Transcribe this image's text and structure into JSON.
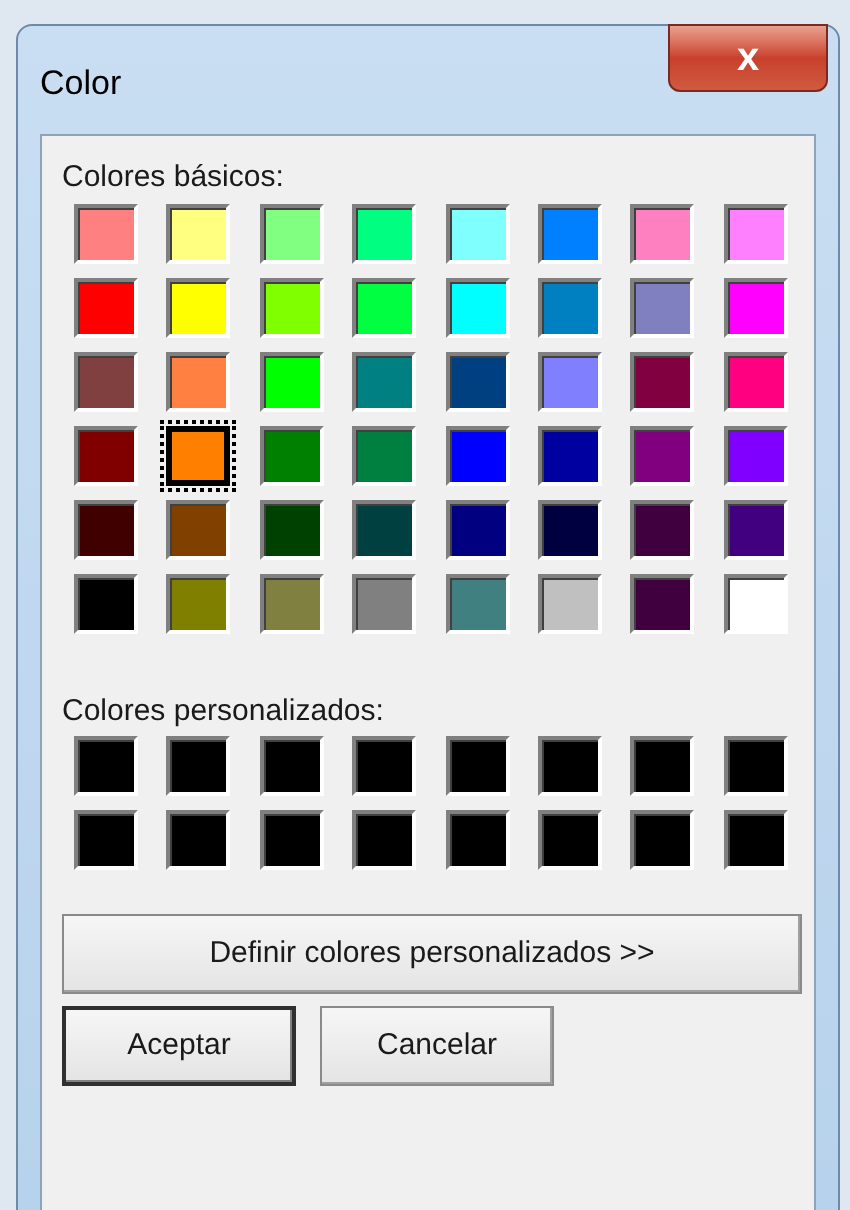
{
  "window": {
    "title": "Color",
    "close": "x"
  },
  "basic_label": "Colores básicos:",
  "basic_colors": [
    {
      "color": "#ff8080",
      "selected": false
    },
    {
      "color": "#ffff80",
      "selected": false
    },
    {
      "color": "#80ff80",
      "selected": false
    },
    {
      "color": "#00ff80",
      "selected": false
    },
    {
      "color": "#80ffff",
      "selected": false
    },
    {
      "color": "#0080ff",
      "selected": false
    },
    {
      "color": "#ff80c0",
      "selected": false
    },
    {
      "color": "#ff80ff",
      "selected": false
    },
    {
      "color": "#ff0000",
      "selected": false
    },
    {
      "color": "#ffff00",
      "selected": false
    },
    {
      "color": "#80ff00",
      "selected": false
    },
    {
      "color": "#00ff40",
      "selected": false
    },
    {
      "color": "#00ffff",
      "selected": false
    },
    {
      "color": "#0080c0",
      "selected": false
    },
    {
      "color": "#8080c0",
      "selected": false
    },
    {
      "color": "#ff00ff",
      "selected": false
    },
    {
      "color": "#804040",
      "selected": false
    },
    {
      "color": "#ff8040",
      "selected": false
    },
    {
      "color": "#00ff00",
      "selected": false
    },
    {
      "color": "#008080",
      "selected": false
    },
    {
      "color": "#004080",
      "selected": false
    },
    {
      "color": "#8080ff",
      "selected": false
    },
    {
      "color": "#800040",
      "selected": false
    },
    {
      "color": "#ff0080",
      "selected": false
    },
    {
      "color": "#800000",
      "selected": false
    },
    {
      "color": "#ff8000",
      "selected": true
    },
    {
      "color": "#008000",
      "selected": false
    },
    {
      "color": "#008040",
      "selected": false
    },
    {
      "color": "#0000ff",
      "selected": false
    },
    {
      "color": "#0000a0",
      "selected": false
    },
    {
      "color": "#800080",
      "selected": false
    },
    {
      "color": "#8000ff",
      "selected": false
    },
    {
      "color": "#400000",
      "selected": false
    },
    {
      "color": "#804000",
      "selected": false
    },
    {
      "color": "#004000",
      "selected": false
    },
    {
      "color": "#004040",
      "selected": false
    },
    {
      "color": "#000080",
      "selected": false
    },
    {
      "color": "#000040",
      "selected": false
    },
    {
      "color": "#400040",
      "selected": false
    },
    {
      "color": "#400080",
      "selected": false
    },
    {
      "color": "#000000",
      "selected": false
    },
    {
      "color": "#808000",
      "selected": false
    },
    {
      "color": "#808040",
      "selected": false
    },
    {
      "color": "#808080",
      "selected": false
    },
    {
      "color": "#408080",
      "selected": false
    },
    {
      "color": "#c0c0c0",
      "selected": false
    },
    {
      "color": "#400040",
      "selected": false
    },
    {
      "color": "#ffffff",
      "selected": false
    }
  ],
  "custom_label": "Colores personalizados:",
  "custom_colors": [
    {
      "color": "#000000",
      "selected": false
    },
    {
      "color": "#000000",
      "selected": false
    },
    {
      "color": "#000000",
      "selected": false
    },
    {
      "color": "#000000",
      "selected": false
    },
    {
      "color": "#000000",
      "selected": false
    },
    {
      "color": "#000000",
      "selected": false
    },
    {
      "color": "#000000",
      "selected": false
    },
    {
      "color": "#000000",
      "selected": false
    },
    {
      "color": "#000000",
      "selected": false
    },
    {
      "color": "#000000",
      "selected": false
    },
    {
      "color": "#000000",
      "selected": false
    },
    {
      "color": "#000000",
      "selected": false
    },
    {
      "color": "#000000",
      "selected": false
    },
    {
      "color": "#000000",
      "selected": false
    },
    {
      "color": "#000000",
      "selected": false
    },
    {
      "color": "#000000",
      "selected": false
    }
  ],
  "define_button": "Definir colores personalizados >>",
  "buttons": [
    {
      "label": "Aceptar",
      "kind": "default"
    },
    {
      "label": "Cancelar",
      "kind": "normal"
    }
  ]
}
